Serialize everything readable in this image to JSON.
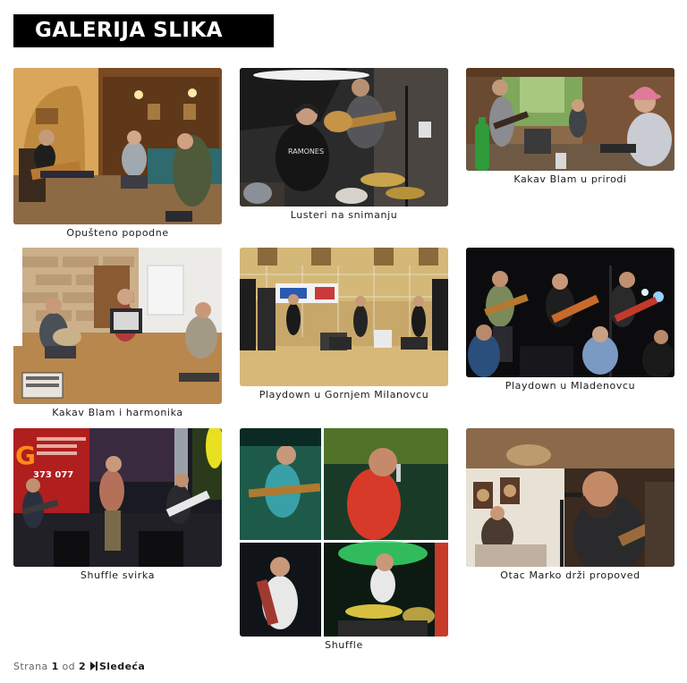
{
  "page": {
    "title": "GALERIJA SLIKA"
  },
  "gallery": [
    {
      "caption": "Opušteno popodne"
    },
    {
      "caption": "Lusteri na snimanju"
    },
    {
      "caption": "Kakav Blam u prirodi"
    },
    {
      "caption": "Kakav Blam i harmonika"
    },
    {
      "caption": "Playdown u Gornjem Milanovcu"
    },
    {
      "caption": "Playdown u Mladenovcu"
    },
    {
      "caption": "Shuffle svirka"
    },
    {
      "caption": "Shuffle"
    },
    {
      "caption": "Otac Marko drži propoved"
    }
  ],
  "photo_texts": {
    "shirt_print": "RAMONES",
    "banner_letter": "G",
    "banner_phone": "373 077"
  },
  "pagination": {
    "prefix": "Strana",
    "current": "1",
    "separator": "od",
    "total": "2",
    "next_label": "Sledeća"
  },
  "colors": {
    "title_bg": "#000000",
    "title_text": "#ffffff",
    "caption_text": "#1b1b1b",
    "pager_muted": "#666666"
  }
}
